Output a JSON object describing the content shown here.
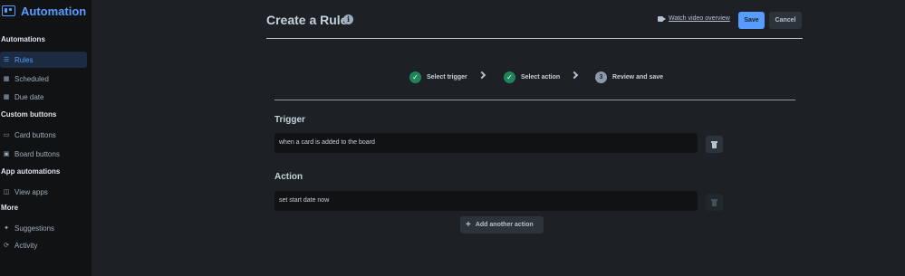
{
  "app": {
    "title": "Automation"
  },
  "sidebar": {
    "sections": [
      {
        "label": "Automations"
      },
      {
        "label": "Custom buttons"
      },
      {
        "label": "App automations"
      },
      {
        "label": "More"
      }
    ],
    "items": [
      {
        "label": "Rules",
        "icon": "sliders-icon",
        "active": true
      },
      {
        "label": "Scheduled",
        "icon": "calendar-icon"
      },
      {
        "label": "Due date",
        "icon": "calendar-icon"
      },
      {
        "label": "Card buttons",
        "icon": "card-icon"
      },
      {
        "label": "Board buttons",
        "icon": "board-icon"
      },
      {
        "label": "View apps",
        "icon": "view-icon"
      },
      {
        "label": "Suggestions",
        "icon": "sparkle-icon"
      },
      {
        "label": "Activity",
        "icon": "refresh-icon"
      }
    ]
  },
  "header": {
    "title": "Create a Rule",
    "video_link": "Watch video overview",
    "save_label": "Save",
    "cancel_label": "Cancel"
  },
  "stepper": {
    "steps": [
      {
        "label": "Select trigger",
        "state": "done"
      },
      {
        "label": "Select action",
        "state": "done"
      },
      {
        "label": "Review and save",
        "state": "current",
        "number": "3"
      }
    ]
  },
  "trigger": {
    "heading": "Trigger",
    "value": "when a card is added to the board"
  },
  "action": {
    "heading": "Action",
    "value": "set start date now",
    "add_label": "Add another action"
  },
  "colors": {
    "accent": "#579dff",
    "success": "#1f845a",
    "background": "#1d2125",
    "sidebar": "#101214"
  }
}
